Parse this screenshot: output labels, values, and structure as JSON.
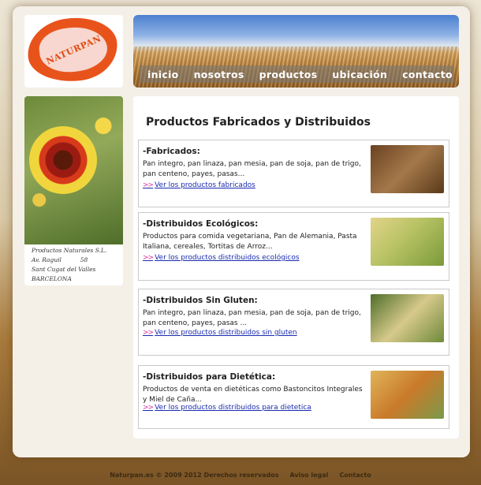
{
  "logo": {
    "text": "NATURPAN"
  },
  "nav": [
    "inicio",
    "nosotros",
    "productos",
    "ubicación",
    "contacto"
  ],
  "sidebar": {
    "address": [
      "Productos Naturales S.L.",
      "Av. Raguil          58",
      "Sant Cugat del Valles",
      "BARCELONA"
    ]
  },
  "main": {
    "title": "Productos Fabricados y Distribuidos",
    "cards": [
      {
        "heading": "-Fabricados:",
        "desc": "Pan integro, pan linaza, pan mesia, pan de soja, pan de trigo, pan centeno, payes, pasas...",
        "arrow": ">>",
        "link": "Ver los productos fabricados",
        "thumb_color": "#8b5a2b"
      },
      {
        "heading": "-Distribuidos Ecológicos:",
        "desc": "Productos para comida vegetariana, Pan de Alemania, Pasta Italiana, cereales, Tortitas de Arroz...",
        "arrow": ">>",
        "link": "Ver los productos distribuidos ecológicos",
        "thumb_color": "#b5a13a"
      },
      {
        "heading": "-Distribuidos Sin Gluten:",
        "desc": "Pan integro, pan linaza, pan mesia, pan de soja, pan de trigo, pan centeno, payes, pasas ...",
        "arrow": ">>",
        "link": "Ver los productos distribuidos sin gluten",
        "thumb_color": "#5d7a3a"
      },
      {
        "heading": "-Distribuidos para Dietética:",
        "desc": "Productos de venta en dietéticas como Bastoncitos Integrales y Miel de Caña...",
        "arrow": ">>",
        "link": "Ver los productos distribuidos para dietetica",
        "thumb_color": "#c98a3a"
      }
    ]
  },
  "footer": {
    "copyright": "Naturpan.es © 2009  2012 Derechos reservados",
    "legal": "Aviso legal",
    "contact": "Contacto"
  }
}
